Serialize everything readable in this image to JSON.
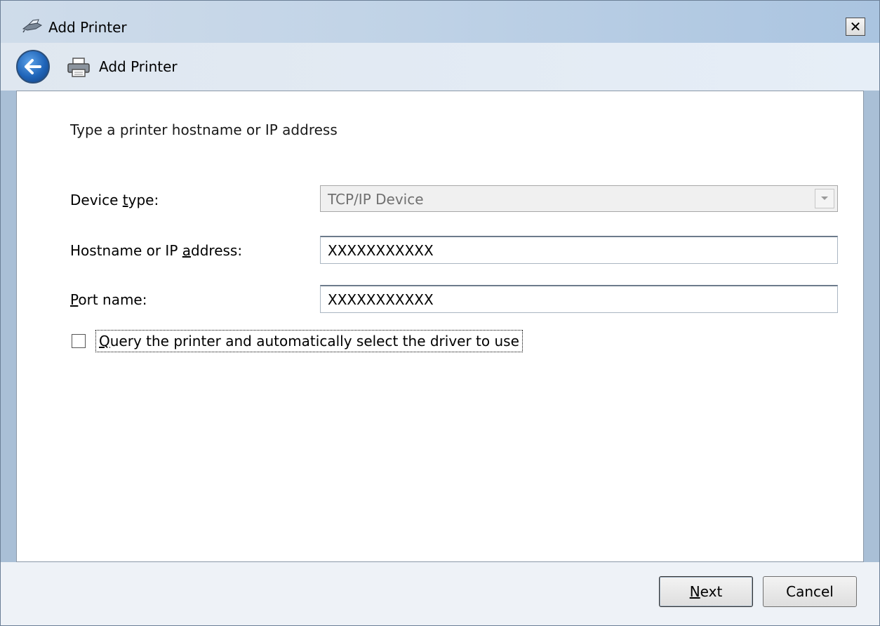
{
  "window": {
    "title": "Add Printer",
    "close_label": "✕"
  },
  "nav": {
    "title": "Add Printer"
  },
  "content": {
    "instruction": "Type a printer hostname or IP address",
    "device_type": {
      "label_pre": "Device ",
      "label_accel": "t",
      "label_post": "ype:",
      "value": "TCP/IP Device"
    },
    "hostname": {
      "label_pre": "Hostname or IP ",
      "label_accel": "a",
      "label_post": "ddress:",
      "value": "XXXXXXXXXXX"
    },
    "port": {
      "label_pre": "",
      "label_accel": "P",
      "label_post": "ort name:",
      "value": "XXXXXXXXXXX"
    },
    "query_checkbox": {
      "label_accel": "Q",
      "label_post": "uery the printer and automatically select the driver to use",
      "checked": false
    }
  },
  "footer": {
    "next_accel": "N",
    "next_post": "ext",
    "cancel_label": "Cancel"
  }
}
